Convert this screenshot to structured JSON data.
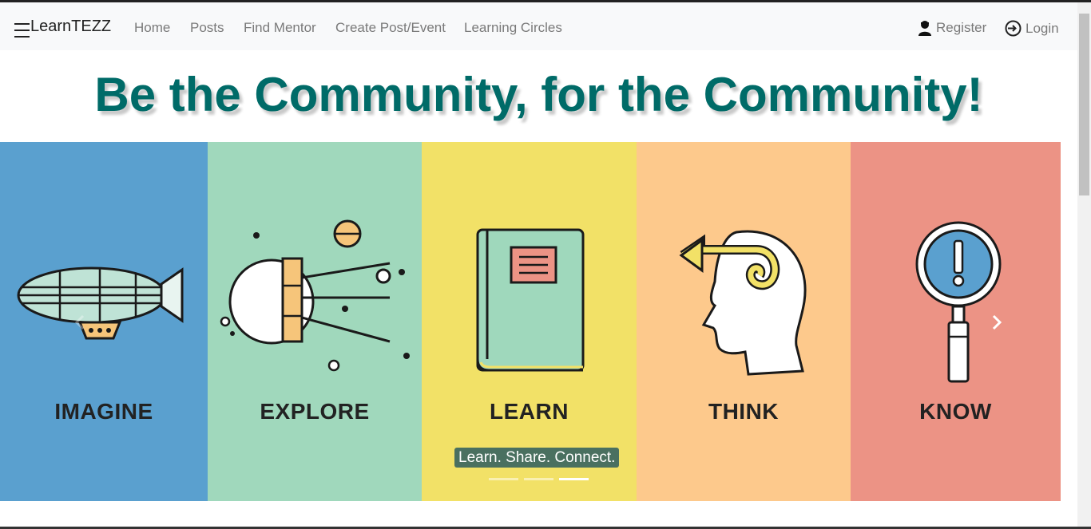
{
  "nav": {
    "brand": "LearnTEZZ",
    "links": [
      "Home",
      "Posts",
      "Find Mentor",
      "Create Post/Event",
      "Learning Circles"
    ],
    "register": "Register",
    "login": "Login"
  },
  "hero": {
    "headline": "Be the Community, for the Community!"
  },
  "carousel": {
    "panels": [
      {
        "label": "IMAGINE",
        "color": "#5aa0cf"
      },
      {
        "label": "EXPLORE",
        "color": "#a0d8bc"
      },
      {
        "label": "LEARN",
        "color": "#f2e167"
      },
      {
        "label": "THINK",
        "color": "#fdc98c"
      },
      {
        "label": "KNOW",
        "color": "#ec9385"
      }
    ],
    "caption": "Learn. Share. Connect.",
    "slide_count": 3,
    "active_slide": 3
  },
  "colors": {
    "accent": "#006b68",
    "navbar_bg": "#f8f9fa",
    "link": "#7a7a7a"
  },
  "icons": [
    "hamburger-icon",
    "user-icon",
    "login-icon",
    "chevron-left-icon",
    "chevron-right-icon"
  ]
}
